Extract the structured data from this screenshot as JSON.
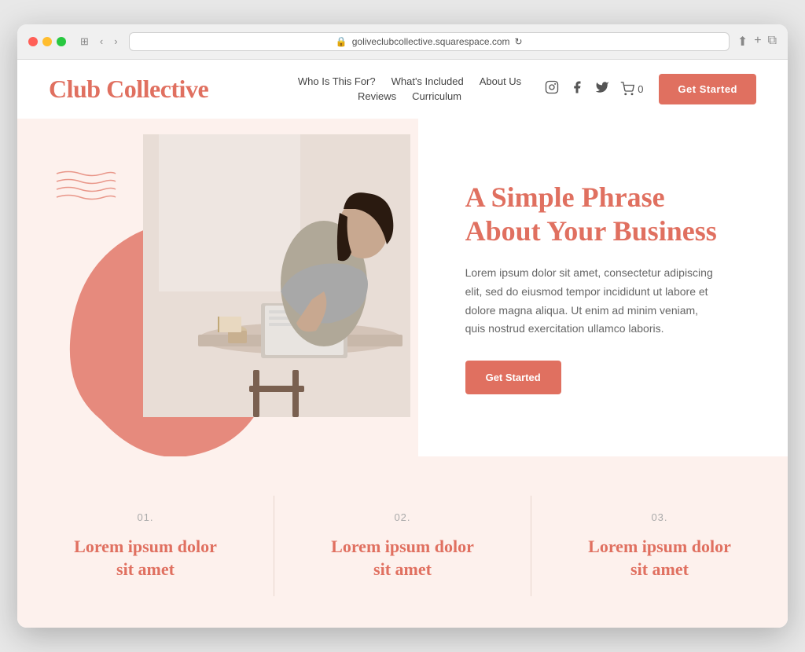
{
  "browser": {
    "url": "goliveclubcollective.squarespace.com",
    "refresh_icon": "↻"
  },
  "nav": {
    "brand": "Club Collective",
    "links_row1": [
      {
        "label": "Who Is This For?",
        "id": "who"
      },
      {
        "label": "What's Included",
        "id": "included"
      },
      {
        "label": "About Us",
        "id": "about"
      }
    ],
    "links_row2": [
      {
        "label": "Reviews",
        "id": "reviews"
      },
      {
        "label": "Curriculum",
        "id": "curriculum"
      }
    ],
    "cart_label": "0",
    "cta_label": "Get Started"
  },
  "hero": {
    "heading_line1": "A Simple Phrase",
    "heading_line2": "About Your Business",
    "body": "Lorem ipsum dolor sit amet, consectetur adipiscing elit, sed do eiusmod tempor incididunt ut labore et dolore magna aliqua. Ut enim ad minim veniam, quis nostrud exercitation ullamco laboris.",
    "cta_label": "Get Started"
  },
  "features": [
    {
      "number": "01.",
      "title_line1": "Lorem ipsum dolor",
      "title_line2": "sit amet"
    },
    {
      "number": "02.",
      "title_line1": "Lorem ipsum dolor",
      "title_line2": "sit amet"
    },
    {
      "number": "03.",
      "title_line1": "Lorem ipsum dolor",
      "title_line2": "sit amet"
    }
  ],
  "colors": {
    "brand": "#e07060",
    "background_light": "#fdf1ed",
    "text_dark": "#444",
    "text_muted": "#666"
  }
}
